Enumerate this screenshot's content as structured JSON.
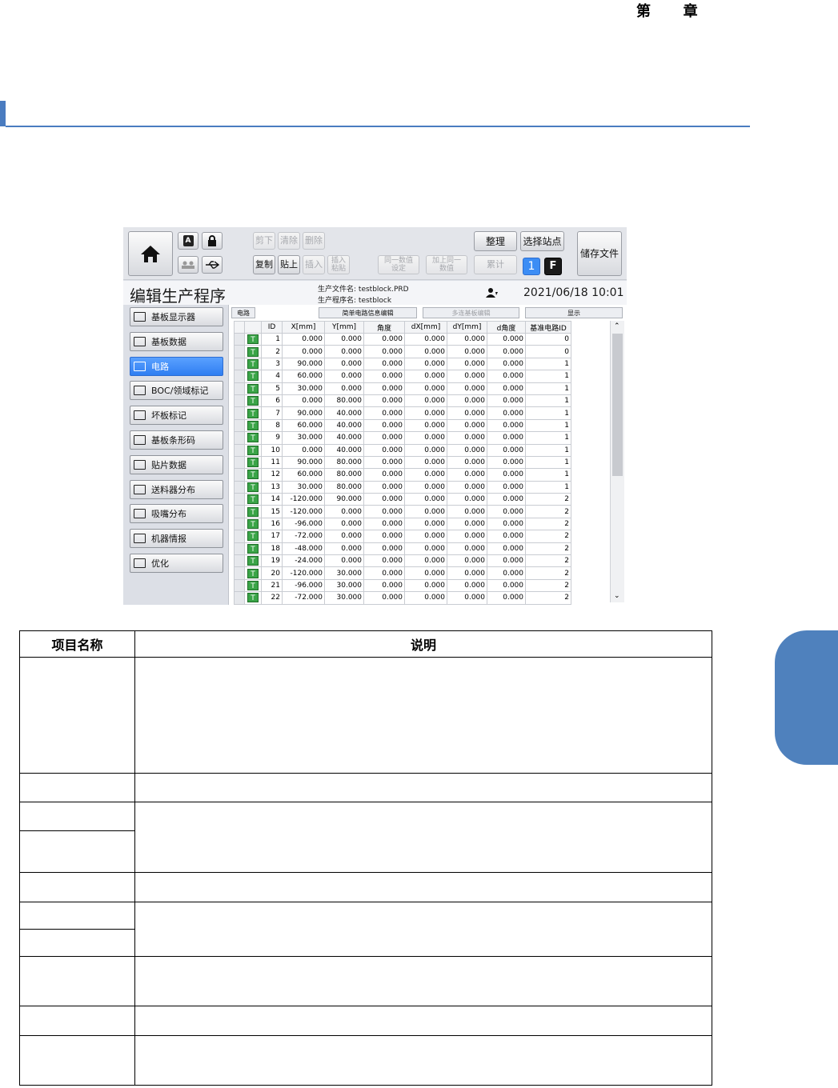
{
  "page": {
    "chapter": [
      "第",
      "章"
    ],
    "accent_color": "#4f81bd"
  },
  "screen": {
    "toolbar": {
      "home_icon": "home-icon",
      "edit_buttons": {
        "cut": "剪下",
        "clear": "清除",
        "delete": "删除",
        "copy": "复制",
        "paste": "贴上",
        "insert": "插入",
        "insert_paste": "插入\n粘贴"
      },
      "same_value": "同一数值\n设定",
      "add_same_value": "加上同一\n数值",
      "accumulate": "累计",
      "organize": "整理",
      "select_station": "选择站点",
      "save_file": "储存文件",
      "station_number": "1",
      "f_label": "F"
    },
    "title": "编辑生产程序",
    "file_label": "生产文件名",
    "file_value": "testblock.PRD",
    "program_label": "生产程序名",
    "program_value": "testblock",
    "datetime": "2021/06/18 10:01",
    "sidebar": [
      {
        "label": "基板显示器",
        "icon": "monitor-icon"
      },
      {
        "label": "基板数据",
        "icon": "board-data-icon"
      },
      {
        "label": "电路",
        "icon": "circuit-icon",
        "active": true
      },
      {
        "label": "BOC/领域标记",
        "icon": "boc-mark-icon"
      },
      {
        "label": "坏板标记",
        "icon": "bad-mark-icon"
      },
      {
        "label": "基板条形码",
        "icon": "barcode-icon"
      },
      {
        "label": "贴片数据",
        "icon": "placement-data-icon"
      },
      {
        "label": "送料器分布",
        "icon": "feeder-icon"
      },
      {
        "label": "吸嘴分布",
        "icon": "nozzle-icon"
      },
      {
        "label": "机器情报",
        "icon": "machine-icon"
      },
      {
        "label": "优化",
        "icon": "optimize-icon"
      }
    ],
    "tabs": {
      "circuit": "电路",
      "simple_edit": "简单电路信息编辑",
      "multi_edit": "多连基板编辑",
      "display": "显示"
    },
    "columns": [
      "ID",
      "X[mm]",
      "Y[mm]",
      "角度",
      "dX[mm]",
      "dY[mm]",
      "d角度",
      "基准电路ID"
    ],
    "rows": [
      [
        "T",
        "1",
        "0.000",
        "0.000",
        "0.000",
        "0.000",
        "0.000",
        "0.000",
        "0"
      ],
      [
        "T",
        "2",
        "0.000",
        "0.000",
        "0.000",
        "0.000",
        "0.000",
        "0.000",
        "0"
      ],
      [
        "T",
        "3",
        "90.000",
        "0.000",
        "0.000",
        "0.000",
        "0.000",
        "0.000",
        "1"
      ],
      [
        "T",
        "4",
        "60.000",
        "0.000",
        "0.000",
        "0.000",
        "0.000",
        "0.000",
        "1"
      ],
      [
        "T",
        "5",
        "30.000",
        "0.000",
        "0.000",
        "0.000",
        "0.000",
        "0.000",
        "1"
      ],
      [
        "T",
        "6",
        "0.000",
        "80.000",
        "0.000",
        "0.000",
        "0.000",
        "0.000",
        "1"
      ],
      [
        "T",
        "7",
        "90.000",
        "40.000",
        "0.000",
        "0.000",
        "0.000",
        "0.000",
        "1"
      ],
      [
        "T",
        "8",
        "60.000",
        "40.000",
        "0.000",
        "0.000",
        "0.000",
        "0.000",
        "1"
      ],
      [
        "T",
        "9",
        "30.000",
        "40.000",
        "0.000",
        "0.000",
        "0.000",
        "0.000",
        "1"
      ],
      [
        "T",
        "10",
        "0.000",
        "40.000",
        "0.000",
        "0.000",
        "0.000",
        "0.000",
        "1"
      ],
      [
        "T",
        "11",
        "90.000",
        "80.000",
        "0.000",
        "0.000",
        "0.000",
        "0.000",
        "1"
      ],
      [
        "T",
        "12",
        "60.000",
        "80.000",
        "0.000",
        "0.000",
        "0.000",
        "0.000",
        "1"
      ],
      [
        "T",
        "13",
        "30.000",
        "80.000",
        "0.000",
        "0.000",
        "0.000",
        "0.000",
        "1"
      ],
      [
        "T",
        "14",
        "-120.000",
        "90.000",
        "0.000",
        "0.000",
        "0.000",
        "0.000",
        "2"
      ],
      [
        "T",
        "15",
        "-120.000",
        "0.000",
        "0.000",
        "0.000",
        "0.000",
        "0.000",
        "2"
      ],
      [
        "T",
        "16",
        "-96.000",
        "0.000",
        "0.000",
        "0.000",
        "0.000",
        "0.000",
        "2"
      ],
      [
        "T",
        "17",
        "-72.000",
        "0.000",
        "0.000",
        "0.000",
        "0.000",
        "0.000",
        "2"
      ],
      [
        "T",
        "18",
        "-48.000",
        "0.000",
        "0.000",
        "0.000",
        "0.000",
        "0.000",
        "2"
      ],
      [
        "T",
        "19",
        "-24.000",
        "0.000",
        "0.000",
        "0.000",
        "0.000",
        "0.000",
        "2"
      ],
      [
        "T",
        "20",
        "-120.000",
        "30.000",
        "0.000",
        "0.000",
        "0.000",
        "0.000",
        "2"
      ],
      [
        "T",
        "21",
        "-96.000",
        "30.000",
        "0.000",
        "0.000",
        "0.000",
        "0.000",
        "2"
      ],
      [
        "T",
        "22",
        "-72.000",
        "30.000",
        "0.000",
        "0.000",
        "0.000",
        "0.000",
        "2"
      ]
    ]
  },
  "desc_table": {
    "headers": [
      "项目名称",
      "说明"
    ]
  }
}
